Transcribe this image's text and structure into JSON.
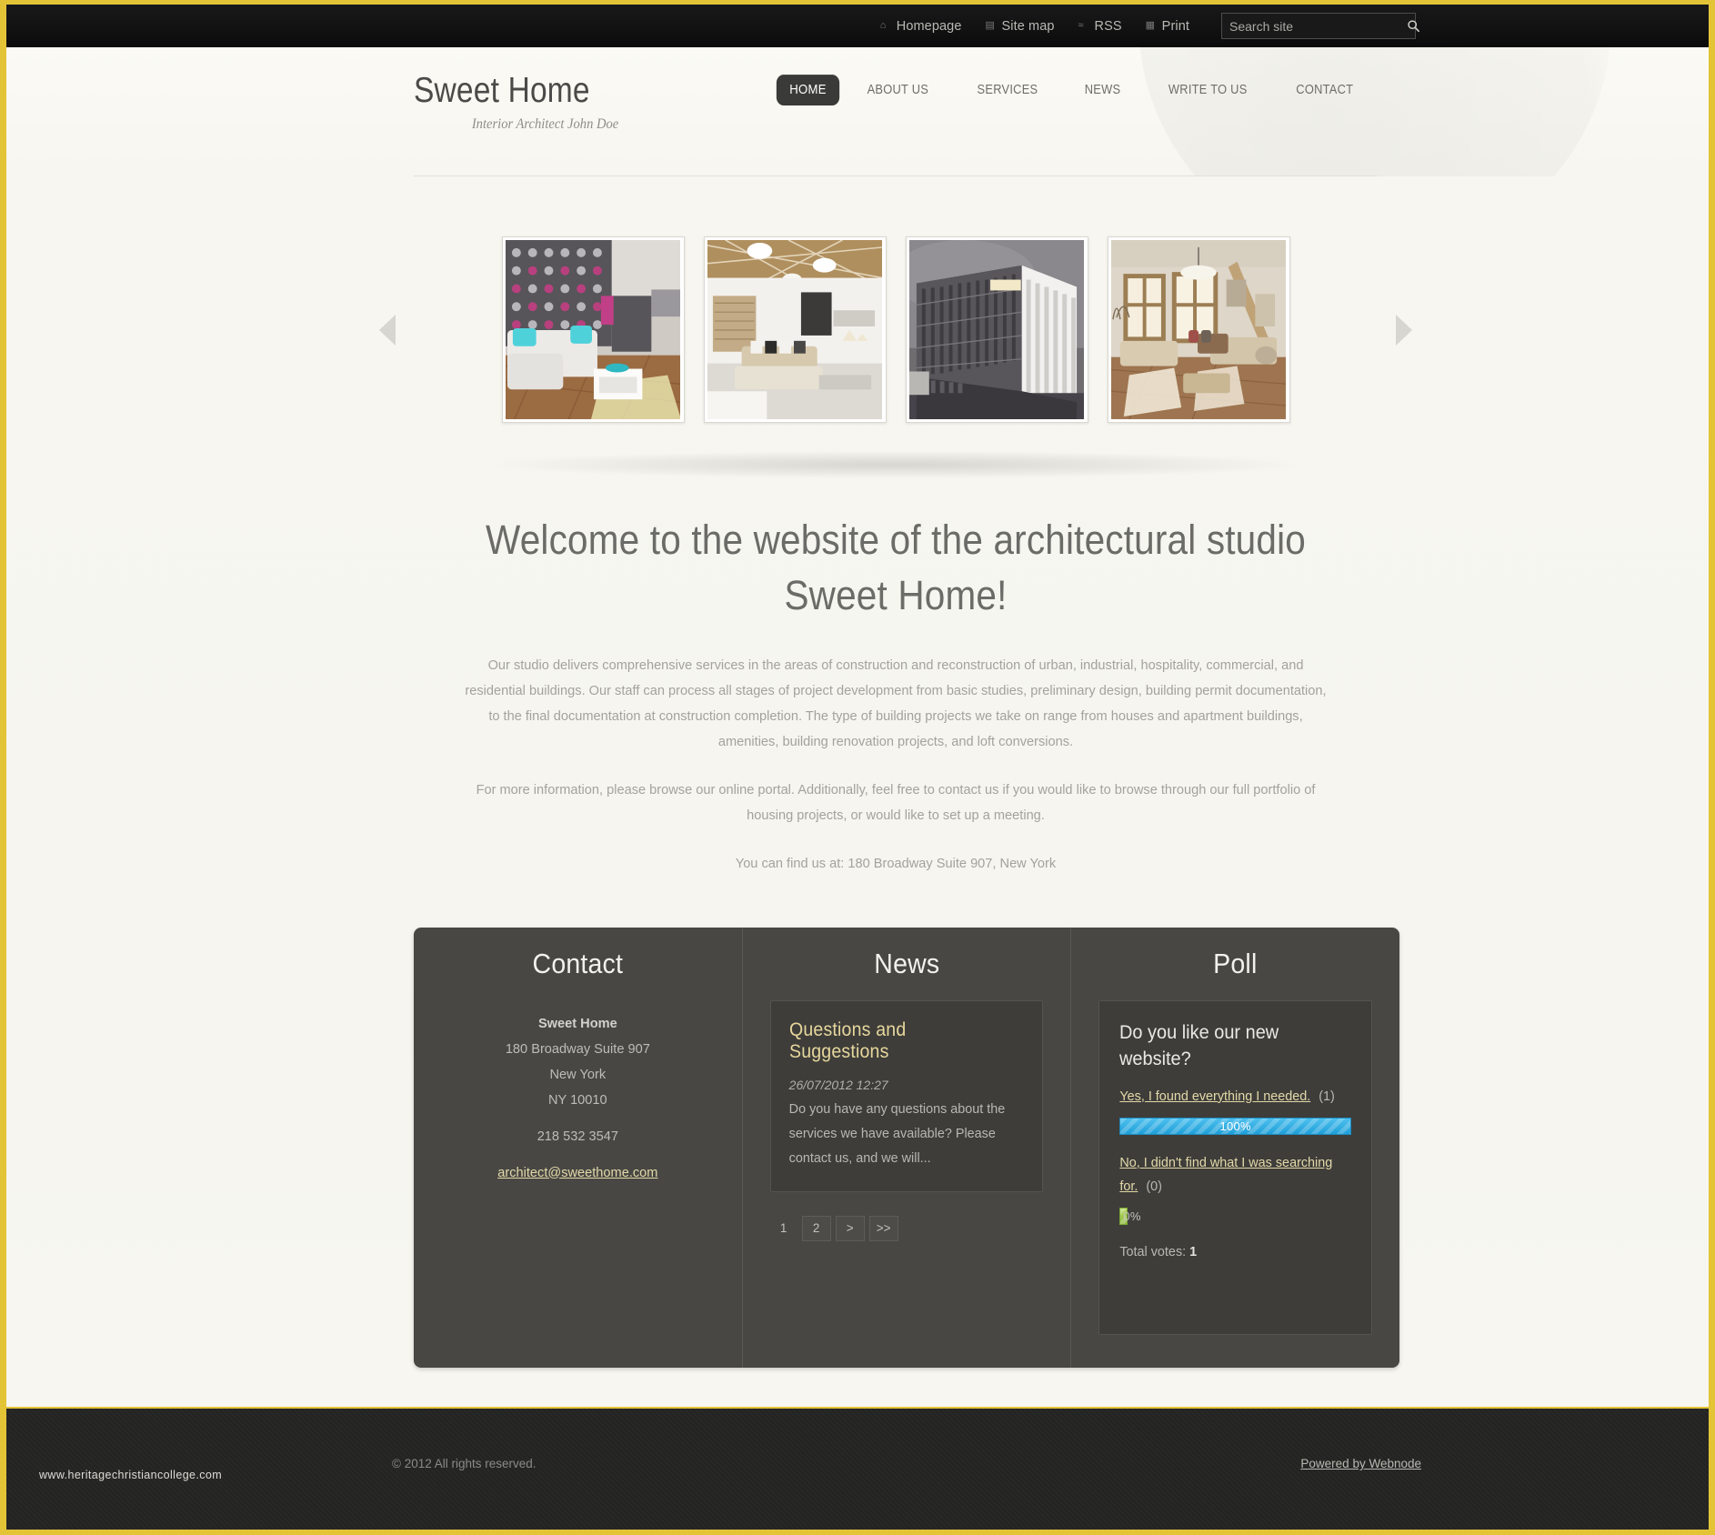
{
  "topbar": {
    "links": [
      {
        "label": "Homepage",
        "icon": "home-icon",
        "glyph": "⌂"
      },
      {
        "label": "Site map",
        "icon": "sitemap-icon",
        "glyph": "▤"
      },
      {
        "label": "RSS",
        "icon": "rss-icon",
        "glyph": "≈"
      },
      {
        "label": "Print",
        "icon": "print-icon",
        "glyph": "▦"
      }
    ],
    "search": {
      "placeholder": "Search site",
      "value": "",
      "icon": "search-icon"
    }
  },
  "header": {
    "logo_title": "Sweet Home",
    "logo_subtitle": "Interior Architect John Doe",
    "nav": [
      {
        "label": "HOME",
        "active": true
      },
      {
        "label": "ABOUT US",
        "active": false
      },
      {
        "label": "SERVICES",
        "active": false
      },
      {
        "label": "NEWS",
        "active": false
      },
      {
        "label": "WRITE TO US",
        "active": false
      },
      {
        "label": "CONTACT",
        "active": false
      }
    ]
  },
  "carousel": {
    "prev_icon": "chevron-left-icon",
    "next_icon": "chevron-right-icon",
    "slides": [
      {
        "alt": "Modern living room with pink dot feature wall"
      },
      {
        "alt": "Loft living room with timber beamed ceiling"
      },
      {
        "alt": "Monochrome office building exterior render"
      },
      {
        "alt": "Sunlit attic lounge with large windows"
      }
    ]
  },
  "main": {
    "heading": "Welcome to the website of the architectural studio Sweet Home!",
    "paragraph1": "Our studio delivers comprehensive services in the areas of construction and reconstruction of urban, industrial, hospitality, commercial, and residential buildings. Our staff can process all stages of project development from basic studies, preliminary design, building permit documentation, to the final documentation at construction completion. The type of building projects we take on range from houses and apartment buildings, amenities, building renovation projects, and loft conversions.",
    "paragraph2": "For more information, please browse our online portal. Additionally, feel free to contact us if you would like to browse through our full portfolio of housing projects, or would like to set up a meeting.",
    "paragraph3": "You can find us at: 180 Broadway Suite 907, New York"
  },
  "contact": {
    "title": "Contact",
    "company": "Sweet Home",
    "address_line1": "180 Broadway Suite 907",
    "address_line2": "New York",
    "address_line3": "NY 10010",
    "phone": "218 532 3547",
    "email": "architect@sweethome.com"
  },
  "news": {
    "title": "News",
    "item_title": "Questions and Suggestions",
    "item_date": "26/07/2012 12:27",
    "item_body": "Do you have any questions about the services we have available? Please contact us, and we will...",
    "pager": [
      {
        "label": "1",
        "current": true
      },
      {
        "label": "2",
        "current": false
      },
      {
        "label": ">",
        "current": false
      },
      {
        "label": ">>",
        "current": false
      }
    ]
  },
  "poll": {
    "title": "Poll",
    "question": "Do you like our new website?",
    "options": [
      {
        "label": "Yes, I found everything I needed.",
        "count": "(1)",
        "percent_label": "100%",
        "percent": 100
      },
      {
        "label": "No, I didn't find what I was searching for.",
        "count": "(0)",
        "percent_label": "0%",
        "percent": 0
      }
    ],
    "total_label": "Total votes:",
    "total_value": "1"
  },
  "footer": {
    "copyright": "© 2012 All rights reserved.",
    "powered": "Powered by Webnode",
    "watermark": "www.heritagechristiancollege.com"
  },
  "colors": {
    "accent_border": "#e3c437",
    "panel_bg": "#484744",
    "link_gold": "#e3d9a8",
    "bar_blue": "#1f9fd8",
    "bar_green": "#8ab83a"
  }
}
